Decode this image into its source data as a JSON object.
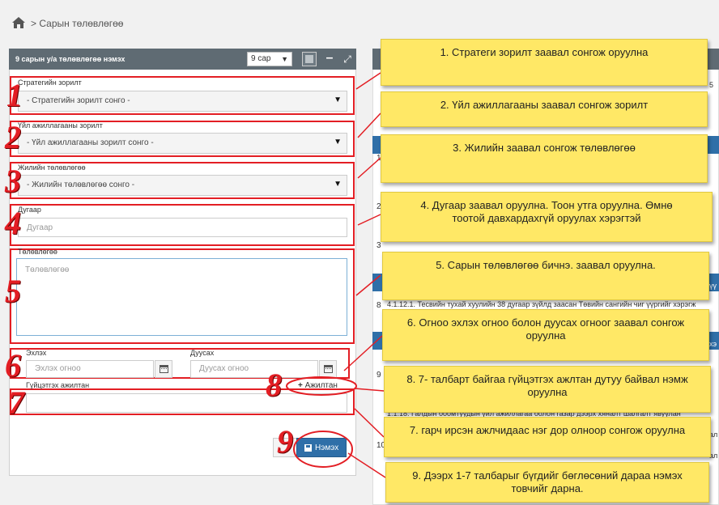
{
  "breadcrumb": {
    "page": "> Сарын төлөвлөгөө"
  },
  "panel": {
    "title": "9 сарын у/а төлөвлөгөө нэмэх",
    "month_select": "9 сар"
  },
  "form": {
    "strategy": {
      "label": "Стратегийн зорилт",
      "value": "- Стратегийн зорилт сонго -"
    },
    "operation": {
      "label": "Үйл ажиллагааны зорилт",
      "value": "- Үйл ажиллагааны зорилт сонго -"
    },
    "yearly": {
      "label": "Жилийн төлөвлөгөө",
      "value": "- Жилийн төлөвлөгөө сонго -"
    },
    "number": {
      "label": "Дугаар",
      "placeholder": "Дугаар"
    },
    "plan": {
      "label": "Төлөвлөгөө",
      "placeholder": "Төлөвлөгөө"
    },
    "start": {
      "label": "Эхлэх",
      "placeholder": "Эхлэх огноо"
    },
    "end": {
      "label": "Дуусах",
      "placeholder": "Дуусах огноо"
    },
    "employee": {
      "label": "Гүйцэтгэх ажилтан",
      "add_label": "Ажилтан"
    },
    "save_label": "Нэмэх"
  },
  "markers": [
    "1",
    "2",
    "3",
    "4",
    "5",
    "6",
    "7",
    "8",
    "9"
  ],
  "notes": [
    "1. Стратеги зорилт заавал сонгож оруулна",
    "2. Үйл ажиллагааны заавал сонгож зорилт",
    "3. Жилийн заавал сонгож төлөвлөгөө",
    "4. Дугаар заавал оруулна. Тоон утга оруулна. Өмнө тоотой давхардахгүй оруулах хэрэгтэй",
    "5. Сарын төлөвлөгөө бичнэ. заавал оруулна.",
    "6. Огноо эхлэх огноо болон дуусах огноог заавал сонгож оруулна",
    "8. 7- талбарт байгаа гүйцэтгэх ажлтан дутуу байвал нэмж оруулна",
    "7. гарч ирсэн ажлчидаас нэг дор олноор сонгож оруулна",
    "9. Дээрх 1-7 талбарыг бүгдийг бөглөсөний дараа нэмэх товчийг дарна."
  ],
  "background_table": {
    "row_numbers": [
      "1",
      "2",
      "3",
      "8",
      "9",
      "10"
    ],
    "row_snippets": [
      "4.1.12.1. Тесвийн тухай хуулийн 38 дугаар зүйлд заасан Төвийн сангийн чиг үүргийг хэрэгж",
      "1.1.18. Галдын боомтуудын үйл ажиллагаа болон газар дээрх хяналт шалгалт явуулан"
    ],
    "right_fragments": [
      "5",
      "үү",
      "хэ",
      "тө",
      "зг",
      "ал",
      "ал",
      "ы"
    ]
  },
  "colors": {
    "accent_red": "#e31e24",
    "note_yellow": "#ffe866",
    "header_gray": "#5f6b73",
    "primary_blue": "#2f6fa8"
  }
}
